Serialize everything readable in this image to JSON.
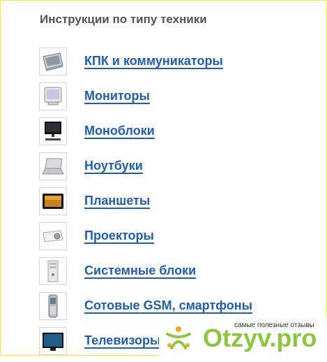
{
  "heading": "Инструкции по типу техники",
  "categories": [
    {
      "label": "КПК и коммуникаторы",
      "icon": "pda-icon"
    },
    {
      "label": "Мониторы",
      "icon": "monitor-icon"
    },
    {
      "label": "Моноблоки",
      "icon": "all-in-one-icon"
    },
    {
      "label": "Ноутбуки",
      "icon": "laptop-icon"
    },
    {
      "label": "Планшеты",
      "icon": "tablet-icon"
    },
    {
      "label": "Проекторы",
      "icon": "projector-icon"
    },
    {
      "label": "Системные блоки",
      "icon": "system-unit-icon"
    },
    {
      "label": "Сотовые GSM, смартфоны",
      "icon": "mobile-phone-icon"
    },
    {
      "label": "Телевизоры Ж",
      "icon": "tv-icon"
    }
  ],
  "watermark": {
    "caption": "самые полезные отзывы",
    "logo_text": "Otzyv.pro"
  },
  "colors": {
    "link": "#1f5fae",
    "heading": "#555555",
    "frame_border": "#f1ef3a",
    "watermark_green": "#8cc63f",
    "watermark_orange": "#f5a623"
  }
}
